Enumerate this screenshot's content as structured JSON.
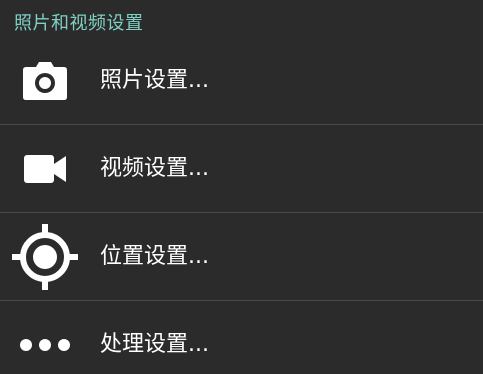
{
  "section": {
    "title": "照片和视频设置"
  },
  "items": [
    {
      "label": "照片设置...",
      "icon": "camera-icon"
    },
    {
      "label": "视频设置...",
      "icon": "video-camera-icon"
    },
    {
      "label": "位置设置...",
      "icon": "location-target-icon"
    },
    {
      "label": "处理设置...",
      "icon": "more-dots-icon"
    }
  ],
  "colors": {
    "background": "#2b2b2b",
    "header_accent": "#7fd1c4",
    "divider": "#4a4a4a",
    "text": "#ffffff"
  }
}
